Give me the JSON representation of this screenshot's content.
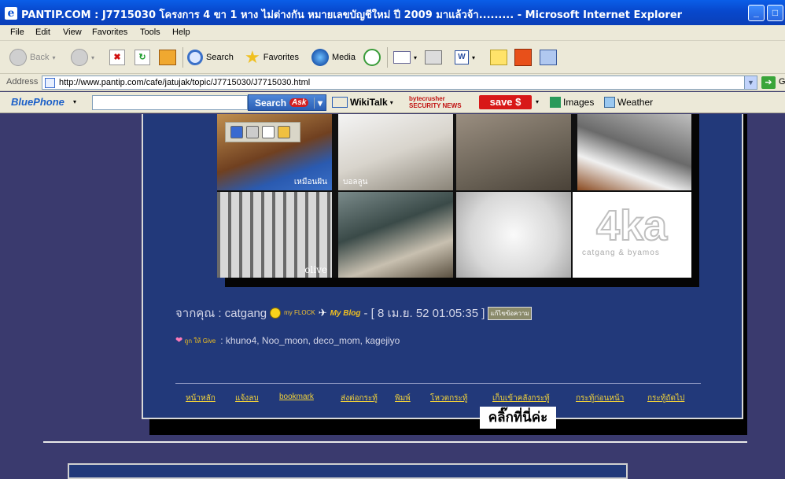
{
  "window": {
    "title": "PANTIP.COM : J7715030 โครงการ 4 ขา 1 หาง ไม่ต่างกัน หมายเลขบัญชีใหม่ ปี 2009 มาแล้วจ้า......... - Microsoft Internet Explorer",
    "buttons": {
      "minimize": "_",
      "maximize": "□",
      "close": "✕"
    }
  },
  "menu": [
    "File",
    "Edit",
    "View",
    "Favorites",
    "Tools",
    "Help"
  ],
  "toolbar": {
    "back": "Back",
    "search": "Search",
    "favorites": "Favorites",
    "media": "Media"
  },
  "address": {
    "label": "Address",
    "url": "http://www.pantip.com/cafe/jatujak/topic/J7715030/J7715030.html",
    "go": "G"
  },
  "bluebar": {
    "logo": "BluePhone",
    "search_btn": "Search",
    "ask": "Ask",
    "wikitalk": "WikiTalk",
    "bytecrusher_top": "bytecrusher",
    "bytecrusher_bottom": "SECURITY NEWS",
    "save": "save $",
    "images": "Images",
    "weather": "Weather"
  },
  "photos": {
    "captions": [
      "เหมือนฝัน",
      "บอลลูน",
      "olive"
    ],
    "logo_big": "4ka",
    "logo_small": "catgang & byamos"
  },
  "post": {
    "from_label": "จากคุณ : catgang",
    "my_flock": "my FLOCK",
    "my_blog": "My Blog",
    "timestamp": "- [ 8 เม.ย. 52 01:05:35 ]",
    "edit": "แก้ไขข้อความ",
    "give_tag": "ถูก ให้ Give",
    "give_list": ": khuno4, Noo_moon, deco_mom, kagejiyo"
  },
  "nav_links": [
    "หน้าหลัก",
    "แจ้งลบ",
    "bookmark",
    "ส่งต่อกระทู้",
    "พิมพ์",
    "โหวตกระทู้",
    "เก็บเข้าคลังกระทู้",
    "กระทู้ก่อนหน้า",
    "กระทู้ถัดไป"
  ],
  "click_here": "คลิ๊กที่นี่ค่ะ",
  "colors": {
    "page_bg": "#3a3a6e",
    "panel_bg": "#22397a",
    "link": "#f2d23a"
  }
}
